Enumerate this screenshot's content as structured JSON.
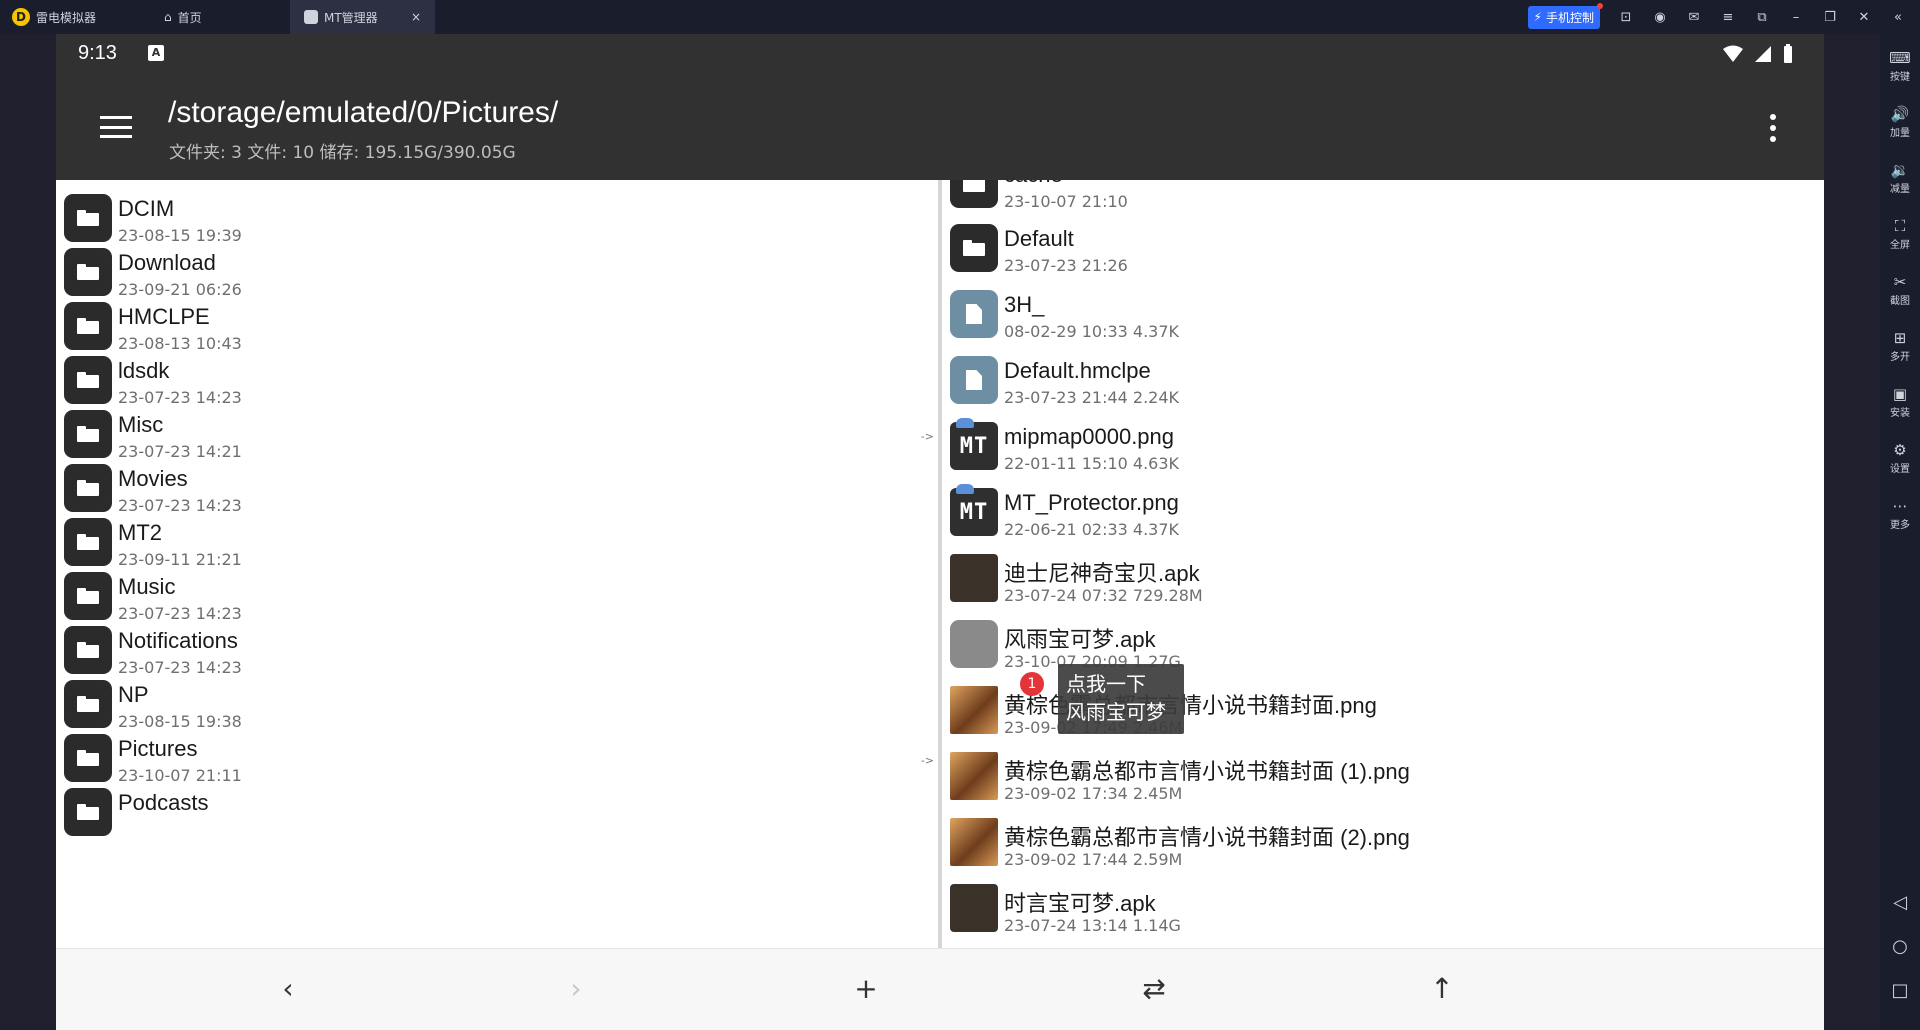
{
  "emulator": {
    "app_name": "雷电模拟器",
    "tabs": [
      {
        "label": "首页",
        "active": false
      },
      {
        "label": "MT管理器",
        "active": true
      }
    ],
    "phone_control_label": "手机控制",
    "sidebar": [
      {
        "icon": "keyboard-icon",
        "label": "按键"
      },
      {
        "icon": "volume-up-icon",
        "label": "加量"
      },
      {
        "icon": "volume-down-icon",
        "label": "减量"
      },
      {
        "icon": "fullscreen-icon",
        "label": "全屏"
      },
      {
        "icon": "scissors-icon",
        "label": "截图"
      },
      {
        "icon": "multi-instance-icon",
        "label": "多开"
      },
      {
        "icon": "apk-install-icon",
        "label": "安装"
      },
      {
        "icon": "settings-icon",
        "label": "设置"
      },
      {
        "icon": "more-icon",
        "label": "更多"
      }
    ]
  },
  "statusbar": {
    "time": "9:13",
    "indicator": "A"
  },
  "toolbar": {
    "path": "/storage/emulated/0/Pictures/",
    "summary": "文件夹: 3  文件: 10  储存: 195.15G/390.05G"
  },
  "left_pane": {
    "items": [
      {
        "name": "DCIM",
        "meta": "23-08-15 19:39",
        "type": "folder"
      },
      {
        "name": "Download",
        "meta": "23-09-21 06:26",
        "type": "folder"
      },
      {
        "name": "HMCLPE",
        "meta": "23-08-13 10:43",
        "type": "folder"
      },
      {
        "name": "ldsdk",
        "meta": "23-07-23 14:23",
        "type": "folder"
      },
      {
        "name": "Misc",
        "meta": "23-07-23 14:21",
        "type": "folder",
        "arrow": "->"
      },
      {
        "name": "Movies",
        "meta": "23-07-23 14:23",
        "type": "folder"
      },
      {
        "name": "MT2",
        "meta": "23-09-11 21:21",
        "type": "folder"
      },
      {
        "name": "Music",
        "meta": "23-07-23 14:23",
        "type": "folder"
      },
      {
        "name": "Notifications",
        "meta": "23-07-23 14:23",
        "type": "folder"
      },
      {
        "name": "NP",
        "meta": "23-08-15 19:38",
        "type": "folder"
      },
      {
        "name": "Pictures",
        "meta": "23-10-07 21:11",
        "type": "folder",
        "arrow": "->"
      },
      {
        "name": "Podcasts",
        "meta": "",
        "type": "folder"
      }
    ]
  },
  "right_pane": {
    "items": [
      {
        "name": "cache",
        "meta": "23-10-07 21:10",
        "type": "folder"
      },
      {
        "name": "Default",
        "meta": "23-07-23 21:26",
        "type": "folder"
      },
      {
        "name": "3H_",
        "meta": "08-02-29 10:33  4.37K",
        "type": "file"
      },
      {
        "name": "Default.hmclpe",
        "meta": "23-07-23 21:44  2.24K",
        "type": "file"
      },
      {
        "name": "mipmap0000.png",
        "meta": "22-01-11 15:10  4.63K",
        "type": "mt"
      },
      {
        "name": "MT_Protector.png",
        "meta": "22-06-21 02:33  4.37K",
        "type": "mt"
      },
      {
        "name": "迪士尼神奇宝贝.apk",
        "meta": "23-07-24 07:32  729.28M",
        "type": "box"
      },
      {
        "name": "风雨宝可梦.apk",
        "meta": "23-10-07 20:09  1.27G",
        "type": "apk"
      },
      {
        "name": "黄棕色霸总都市言情小说书籍封面.png",
        "meta": "23-09-02 17:49  2.46M",
        "type": "photo"
      },
      {
        "name": "黄棕色霸总都市言情小说书籍封面 (1).png",
        "meta": "23-09-02 17:34  2.45M",
        "type": "photo"
      },
      {
        "name": "黄棕色霸总都市言情小说书籍封面 (2).png",
        "meta": "23-09-02 17:44  2.59M",
        "type": "photo"
      },
      {
        "name": "时言宝可梦.apk",
        "meta": "23-07-24 13:14  1.14G",
        "type": "box"
      }
    ]
  },
  "tooltip": {
    "line1": "点我一下",
    "line2": "风雨宝可梦",
    "badge": "1"
  },
  "bottombar": {
    "back": "‹",
    "forward": "›",
    "add": "+",
    "swap": "⇄",
    "up": "↑"
  }
}
